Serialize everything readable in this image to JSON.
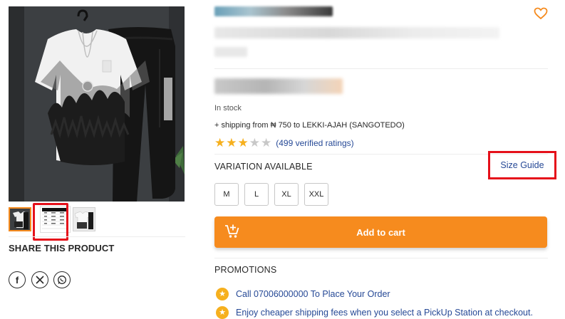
{
  "product": {
    "stock_status": "In stock",
    "shipping": "+ shipping from ₦ 750 to LEKKI-AJAH (SANGOTEDO)",
    "rating": {
      "value": 3,
      "max": 5
    },
    "ratings_text": "(499 verified ratings)"
  },
  "variation": {
    "title": "VARIATION AVAILABLE",
    "size_guide_label": "Size Guide",
    "sizes": [
      "M",
      "L",
      "XL",
      "XXL"
    ]
  },
  "actions": {
    "add_to_cart_label": "Add to cart"
  },
  "share": {
    "title": "SHARE THIS PRODUCT",
    "networks": [
      "facebook-icon",
      "x-icon",
      "whatsapp-icon"
    ]
  },
  "promotions": {
    "title": "PROMOTIONS",
    "items": [
      "Call 07006000000 To Place Your Order",
      "Enjoy cheaper shipping fees when you select a PickUp Station at checkout."
    ]
  },
  "colors": {
    "accent": "#f68b1e",
    "link": "#264996",
    "star": "#f6b01e",
    "highlight": "#e5101a"
  }
}
